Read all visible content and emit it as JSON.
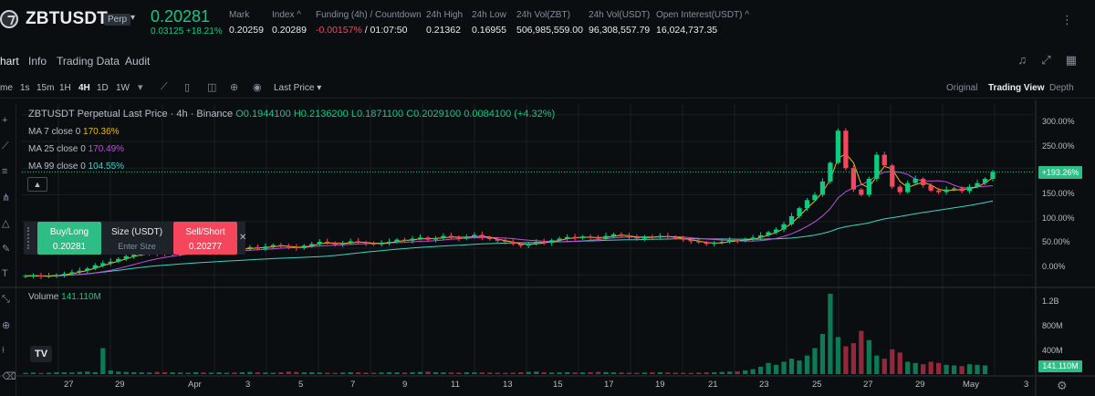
{
  "header": {
    "symbol": "ZBTUSDT",
    "contract_type": "Perp",
    "last_price": "0.20281",
    "change": "0.03125 +18.21%",
    "stats": [
      {
        "label": "Mark",
        "value": "0.20259"
      },
      {
        "label": "Index ^",
        "value": "0.20289"
      },
      {
        "label": "Funding (4h) / Countdown",
        "value_neg": "-0.00157%",
        "value_rest": " / 01:07:50"
      },
      {
        "label": "24h High",
        "value": "0.21362"
      },
      {
        "label": "24h Low",
        "value": "0.16955"
      },
      {
        "label": "24h Vol(ZBT)",
        "value": "506,985,559.00"
      },
      {
        "label": "24h Vol(USDT)",
        "value": "96,308,557.79"
      },
      {
        "label": "Open Interest(USDT) ^",
        "value": "16,024,737.35"
      }
    ]
  },
  "tabs": [
    "hart",
    "Info",
    "Trading Data",
    "Audit"
  ],
  "toolbar": {
    "intervals": [
      "me",
      "1s",
      "15m",
      "1H",
      "4H",
      "1D",
      "1W"
    ],
    "active_interval": "4H",
    "price_type": "Last Price",
    "views": [
      "Original",
      "Trading View",
      "Depth"
    ],
    "active_view": "Trading View"
  },
  "legend": {
    "title": "ZBTUSDT Perpetual Last Price · 4h · Binance",
    "ohlc": "O0.1944100 H0.2136200 L0.1871100 C0.2029100 0.0084100 (+4.32%)",
    "ma7_label": "MA 7 close 0",
    "ma7_value": "170.36%",
    "ma25_label": "MA 25 close 0",
    "ma25_value": "170.49%",
    "ma99_label": "MA 99 close 0",
    "ma99_value": "104.55%"
  },
  "trade_panel": {
    "buy_label": "Buy/Long",
    "buy_price": "0.20281",
    "size_label": "Size (USDT)",
    "size_placeholder": "Enter Size",
    "sell_label": "Sell/Short",
    "sell_price": "0.20277"
  },
  "volume": {
    "label": "Volume",
    "value": "141.110M"
  },
  "price_axis": {
    "ticks": [
      "300.00%",
      "250.00%",
      "200.00%",
      "150.00%",
      "100.00%",
      "50.00%",
      "0.00%"
    ],
    "current_tag": "+193.26%"
  },
  "volume_axis": {
    "ticks": [
      "1.2B",
      "800M",
      "400M"
    ],
    "current_tag": "141.110M"
  },
  "date_axis": [
    "27",
    "29",
    "Apr",
    "3",
    "5",
    "7",
    "9",
    "11",
    "13",
    "15",
    "17",
    "19",
    "21",
    "23",
    "25",
    "27",
    "29",
    "May",
    "3"
  ],
  "colors": {
    "up": "#0ecb81",
    "down": "#f6465d",
    "ma7": "#f0b90b",
    "ma25": "#c34cdd",
    "ma99": "#3ad4c4"
  },
  "chart_data": {
    "type": "candlestick",
    "scale": "percentage",
    "ylim": [
      -20,
      320
    ],
    "y_ticks": [
      0,
      50,
      100,
      150,
      200,
      250,
      300
    ],
    "x_dates": [
      "27",
      "29",
      "Apr",
      "3",
      "5",
      "7",
      "9",
      "11",
      "13",
      "15",
      "17",
      "19",
      "21",
      "23",
      "25",
      "27",
      "29",
      "May",
      "3"
    ],
    "close_pct": [
      -2,
      -1,
      -3,
      -2,
      0,
      2,
      5,
      8,
      12,
      18,
      22,
      25,
      30,
      35,
      38,
      40,
      42,
      40,
      38,
      40,
      42,
      44,
      45,
      43,
      45,
      47,
      48,
      46,
      50,
      52,
      49,
      53,
      56,
      54,
      52,
      50,
      55,
      58,
      62,
      60,
      57,
      60,
      63,
      61,
      59,
      57,
      60,
      62,
      66,
      64,
      68,
      70,
      66,
      69,
      73,
      71,
      68,
      72,
      75,
      70,
      67,
      64,
      62,
      58,
      55,
      58,
      62,
      60,
      65,
      68,
      71,
      69,
      72,
      70,
      68,
      73,
      76,
      74,
      70,
      68,
      72,
      70,
      73,
      71,
      69,
      66,
      63,
      61,
      58,
      60,
      62,
      65,
      64,
      66,
      70,
      74,
      80,
      85,
      95,
      110,
      125,
      140,
      150,
      175,
      210,
      270,
      200,
      160,
      150,
      180,
      225,
      205,
      165,
      155,
      172,
      180,
      168,
      158,
      155,
      160,
      162,
      157,
      165,
      172,
      180,
      193
    ],
    "ma_series": [
      {
        "name": "MA 7 close 0",
        "last": 170.36
      },
      {
        "name": "MA 25 close 0",
        "last": 170.49
      },
      {
        "name": "MA 99 close 0",
        "last": 104.55
      }
    ],
    "volume_axis_ticks": [
      "1.2B",
      "800M",
      "400M"
    ],
    "volume_max": 1300,
    "volume_m": [
      20,
      25,
      18,
      22,
      30,
      28,
      25,
      35,
      40,
      30,
      420,
      60,
      40,
      35,
      30,
      28,
      25,
      35,
      30,
      28,
      25,
      22,
      30,
      26,
      24,
      28,
      22,
      25,
      30,
      35,
      28,
      25,
      22,
      30,
      40,
      35,
      28,
      30,
      25,
      22,
      20,
      25,
      30,
      28,
      24,
      22,
      26,
      30,
      28,
      25,
      30,
      35,
      40,
      30,
      28,
      25,
      24,
      30,
      28,
      26,
      25,
      22,
      20,
      24,
      30,
      35,
      40,
      30,
      25,
      28,
      30,
      26,
      28,
      30,
      35,
      32,
      28,
      25,
      22,
      20,
      25,
      28,
      30,
      26,
      24,
      22,
      20,
      25,
      28,
      30,
      35,
      40,
      45,
      60,
      80,
      120,
      180,
      150,
      200,
      250,
      220,
      300,
      420,
      650,
      1300,
      600,
      450,
      500,
      700,
      550,
      300,
      250,
      400,
      350,
      200,
      180,
      160,
      200,
      180,
      150,
      140,
      130,
      160,
      150,
      141
    ]
  }
}
